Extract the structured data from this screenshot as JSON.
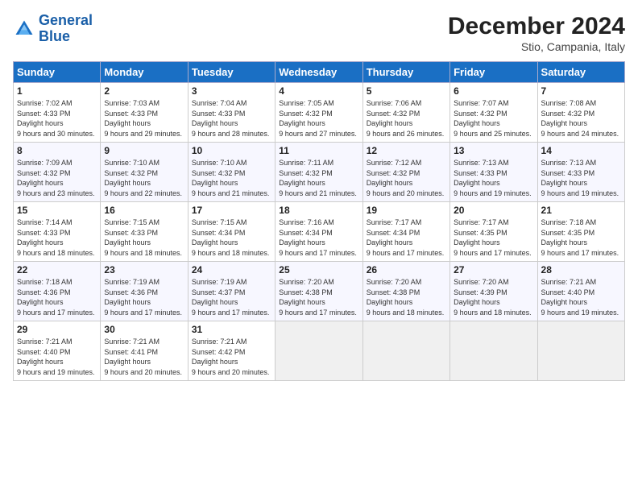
{
  "header": {
    "logo_line1": "General",
    "logo_line2": "Blue",
    "month": "December 2024",
    "location": "Stio, Campania, Italy"
  },
  "weekdays": [
    "Sunday",
    "Monday",
    "Tuesday",
    "Wednesday",
    "Thursday",
    "Friday",
    "Saturday"
  ],
  "weeks": [
    [
      {
        "day": "1",
        "sunrise": "7:02 AM",
        "sunset": "4:33 PM",
        "daylight": "9 hours and 30 minutes."
      },
      {
        "day": "2",
        "sunrise": "7:03 AM",
        "sunset": "4:33 PM",
        "daylight": "9 hours and 29 minutes."
      },
      {
        "day": "3",
        "sunrise": "7:04 AM",
        "sunset": "4:33 PM",
        "daylight": "9 hours and 28 minutes."
      },
      {
        "day": "4",
        "sunrise": "7:05 AM",
        "sunset": "4:32 PM",
        "daylight": "9 hours and 27 minutes."
      },
      {
        "day": "5",
        "sunrise": "7:06 AM",
        "sunset": "4:32 PM",
        "daylight": "9 hours and 26 minutes."
      },
      {
        "day": "6",
        "sunrise": "7:07 AM",
        "sunset": "4:32 PM",
        "daylight": "9 hours and 25 minutes."
      },
      {
        "day": "7",
        "sunrise": "7:08 AM",
        "sunset": "4:32 PM",
        "daylight": "9 hours and 24 minutes."
      }
    ],
    [
      {
        "day": "8",
        "sunrise": "7:09 AM",
        "sunset": "4:32 PM",
        "daylight": "9 hours and 23 minutes."
      },
      {
        "day": "9",
        "sunrise": "7:10 AM",
        "sunset": "4:32 PM",
        "daylight": "9 hours and 22 minutes."
      },
      {
        "day": "10",
        "sunrise": "7:10 AM",
        "sunset": "4:32 PM",
        "daylight": "9 hours and 21 minutes."
      },
      {
        "day": "11",
        "sunrise": "7:11 AM",
        "sunset": "4:32 PM",
        "daylight": "9 hours and 21 minutes."
      },
      {
        "day": "12",
        "sunrise": "7:12 AM",
        "sunset": "4:32 PM",
        "daylight": "9 hours and 20 minutes."
      },
      {
        "day": "13",
        "sunrise": "7:13 AM",
        "sunset": "4:33 PM",
        "daylight": "9 hours and 19 minutes."
      },
      {
        "day": "14",
        "sunrise": "7:13 AM",
        "sunset": "4:33 PM",
        "daylight": "9 hours and 19 minutes."
      }
    ],
    [
      {
        "day": "15",
        "sunrise": "7:14 AM",
        "sunset": "4:33 PM",
        "daylight": "9 hours and 18 minutes."
      },
      {
        "day": "16",
        "sunrise": "7:15 AM",
        "sunset": "4:33 PM",
        "daylight": "9 hours and 18 minutes."
      },
      {
        "day": "17",
        "sunrise": "7:15 AM",
        "sunset": "4:34 PM",
        "daylight": "9 hours and 18 minutes."
      },
      {
        "day": "18",
        "sunrise": "7:16 AM",
        "sunset": "4:34 PM",
        "daylight": "9 hours and 17 minutes."
      },
      {
        "day": "19",
        "sunrise": "7:17 AM",
        "sunset": "4:34 PM",
        "daylight": "9 hours and 17 minutes."
      },
      {
        "day": "20",
        "sunrise": "7:17 AM",
        "sunset": "4:35 PM",
        "daylight": "9 hours and 17 minutes."
      },
      {
        "day": "21",
        "sunrise": "7:18 AM",
        "sunset": "4:35 PM",
        "daylight": "9 hours and 17 minutes."
      }
    ],
    [
      {
        "day": "22",
        "sunrise": "7:18 AM",
        "sunset": "4:36 PM",
        "daylight": "9 hours and 17 minutes."
      },
      {
        "day": "23",
        "sunrise": "7:19 AM",
        "sunset": "4:36 PM",
        "daylight": "9 hours and 17 minutes."
      },
      {
        "day": "24",
        "sunrise": "7:19 AM",
        "sunset": "4:37 PM",
        "daylight": "9 hours and 17 minutes."
      },
      {
        "day": "25",
        "sunrise": "7:20 AM",
        "sunset": "4:38 PM",
        "daylight": "9 hours and 17 minutes."
      },
      {
        "day": "26",
        "sunrise": "7:20 AM",
        "sunset": "4:38 PM",
        "daylight": "9 hours and 18 minutes."
      },
      {
        "day": "27",
        "sunrise": "7:20 AM",
        "sunset": "4:39 PM",
        "daylight": "9 hours and 18 minutes."
      },
      {
        "day": "28",
        "sunrise": "7:21 AM",
        "sunset": "4:40 PM",
        "daylight": "9 hours and 19 minutes."
      }
    ],
    [
      {
        "day": "29",
        "sunrise": "7:21 AM",
        "sunset": "4:40 PM",
        "daylight": "9 hours and 19 minutes."
      },
      {
        "day": "30",
        "sunrise": "7:21 AM",
        "sunset": "4:41 PM",
        "daylight": "9 hours and 20 minutes."
      },
      {
        "day": "31",
        "sunrise": "7:21 AM",
        "sunset": "4:42 PM",
        "daylight": "9 hours and 20 minutes."
      },
      null,
      null,
      null,
      null
    ]
  ]
}
